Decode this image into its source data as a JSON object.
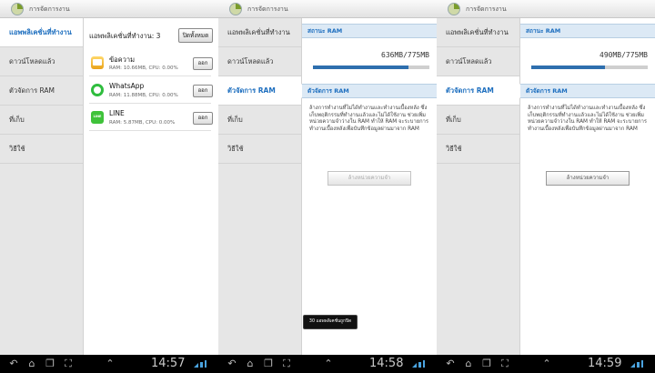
{
  "app_title": "การจัดการงาน",
  "sidebar": {
    "items": [
      {
        "label": "แอพพลิเคชั่นที่ทำงาน"
      },
      {
        "label": "ดาวน์โหลดแล้ว"
      },
      {
        "label": "ตัวจัดการ RAM"
      },
      {
        "label": "ที่เก็บ"
      },
      {
        "label": "วิธีใช้"
      }
    ]
  },
  "running": {
    "header": "แอพพลิเคชั่นที่ทำงาน: 3",
    "end_all_label": "ปิดทั้งหมด",
    "apps": [
      {
        "name": "ข้อความ",
        "meta": "RAM: 10.66MB, CPU: 0.00%",
        "icon": "messages-icon",
        "end_label": "ออก"
      },
      {
        "name": "WhatsApp",
        "meta": "RAM: 11.88MB, CPU: 0.00%",
        "icon": "whatsapp-icon",
        "end_label": "ออก"
      },
      {
        "name": "LINE",
        "meta": "RAM: 5.87MB, CPU: 0.00%",
        "icon": "line-icon",
        "end_label": "ออก"
      }
    ]
  },
  "ram_panels": [
    {
      "status_header": "สถานะ RAM",
      "ram_text": "636MB/775MB",
      "used_fraction": 0.82,
      "manager_header": "ตัวจัดการ RAM",
      "description": "ล้างการทำงานที่ไม่ได้ทำงานและทำงานเบื้องหลัง ซึ่งเก็บพฤติกรรมที่ทำงานแล้วและไม่ได้ใช้งาน ช่วยเพิ่มหน่วยความจำว่างใน RAM ทำให้ RAM จะระบายการทำงานเบื้องหลังเพื่อบันทึกข้อมูลผ่านมาจาก RAM",
      "button_label": "ล้างหน่วยความจำ",
      "button_disabled": true
    },
    {
      "status_header": "สถานะ RAM",
      "ram_text": "490MB/775MB",
      "used_fraction": 0.63,
      "manager_header": "ตัวจัดการ RAM",
      "description": "ล้างการทำงานที่ไม่ได้ทำงานและทำงานเบื้องหลัง ซึ่งเก็บพฤติกรรมที่ทำงานแล้วและไม่ได้ใช้งาน ช่วยเพิ่มหน่วยความจำว่างใน RAM ทำให้ RAM จะระบายการทำงานเบื้องหลังเพื่อบันทึกข้อมูลผ่านมาจาก RAM",
      "button_label": "ล้างหน่วยความจำ",
      "button_disabled": false
    }
  ],
  "toast": "30 แอพพลิเคชั่นถูกปิด",
  "clocks": [
    "14:57",
    "14:58",
    "14:59"
  ],
  "colors": {
    "accent": "#1e6fbf",
    "bar_fill": "#2e6fae",
    "section_bg": "#dce9f5"
  }
}
